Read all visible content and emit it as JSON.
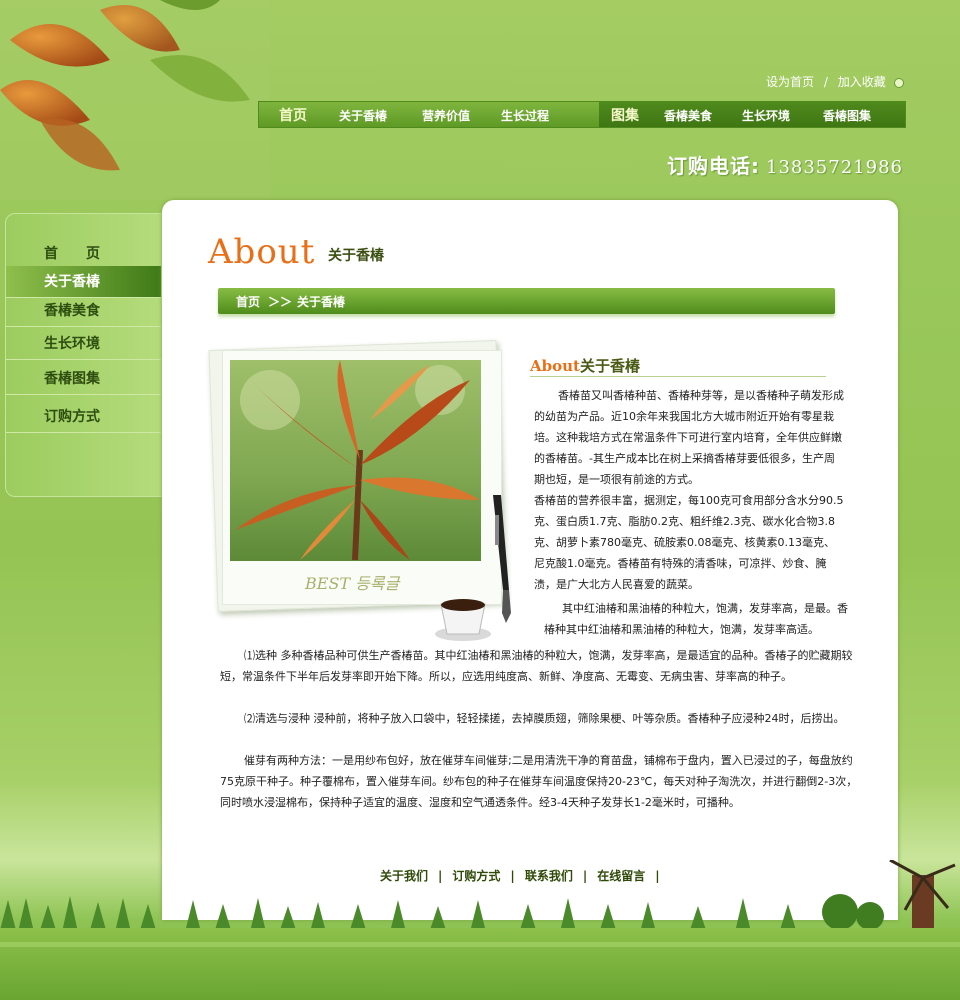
{
  "header": {
    "top_links": {
      "set_home": "设为首页",
      "separator": "/",
      "add_favorite": "加入收藏"
    },
    "nav_left": [
      {
        "label": "首页"
      },
      {
        "label": "关于香椿"
      },
      {
        "label": "营养价值"
      },
      {
        "label": "生长过程"
      }
    ],
    "nav_right": [
      {
        "label": "图集"
      },
      {
        "label": "香椿美食"
      },
      {
        "label": "生长环境"
      },
      {
        "label": "香椿图集"
      }
    ],
    "phone_label": "订购电话:",
    "phone_number": "13835721986"
  },
  "sidebar": {
    "items": [
      {
        "label": "首　　页"
      },
      {
        "label": "关于香椿"
      },
      {
        "label": "香椿美食"
      },
      {
        "label": "生长环境"
      },
      {
        "label": "香椿图集"
      },
      {
        "label": "订购方式"
      }
    ]
  },
  "main": {
    "title_en": "About",
    "title_cn": "关于香椿",
    "breadcrumb": {
      "home": "首页",
      "arrows": "＞＞",
      "current": "关于香椿"
    },
    "photo_caption": "BEST 등록글",
    "article_title_en": "About",
    "article_title_cn": "关于香椿",
    "paragraphs": [
      "香椿苗又叫香椿种苗、香椿种芽等，是以香椿种子萌发形成的幼苗为产品。近10余年来我国北方大城市附近开始有零星栽培。这种栽培方式在常温条件下可进行室内培育，全年供应鲜嫩的香椿苗。-其生产成本比在树上采摘香椿芽要低很多，生产周期也短，是一项很有前途的方式。",
      "香椿苗的营养很丰富，据测定，每100克可食用部分含水分90.5克、蛋白质1.7克、脂肪0.2克、粗纤维2.3克、碳水化合物3.8克、胡萝卜素780毫克、硫胺素0.08毫克、核黄素0.13毫克、尼克酸1.0毫克。香椿苗有特殊的清香味，可凉拌、炒食、腌渍，是广大北方人民喜爱的蔬菜。",
      "其中红油椿和黑油椿的种粒大，饱满，发芽率高，是最。香椿种其中红油椿和黑油椿的种粒大，饱满，发芽率高适。",
      "⑴选种  多种香椿品种可供生产香椿苗。其中红油椿和黑油椿的种粒大，饱满，发芽率高，是最适宜的品种。香椿子的贮藏期较短，常温条件下半年后发芽率即开始下降。所以，应选用纯度高、新鲜、净度高、无霉变、无病虫害、芽率高的种子。",
      "⑵清选与浸种  浸种前，将种子放入口袋中，轻轻揉搓，去掉膜质翅，筛除果梗、叶等杂质。香椿种子应浸种24时，后捞出。",
      "催芽有两种方法：一是用纱布包好，放在催芽车间催芽;二是用清洗干净的育苗盘，铺棉布于盘内，置入已浸过的子，每盘放约75克原干种子。种子覆棉布，置入催芽车间。纱布包的种子在催芽车间温度保持20-23℃，每天对种子淘洗次，并进行翻倒2-3次，同时喷水浸湿棉布，保持种子适宜的温度、湿度和空气通透条件。经3-4天种子发芽长1-2毫米时，可播种。"
    ]
  },
  "footer": {
    "links": [
      "关于我们",
      "订购方式",
      "联系我们",
      "在线留言"
    ],
    "separator": "|"
  },
  "colors": {
    "accent_orange": "#e86f16",
    "nav_green": "#5e9a25",
    "dark_green": "#3f7612"
  }
}
